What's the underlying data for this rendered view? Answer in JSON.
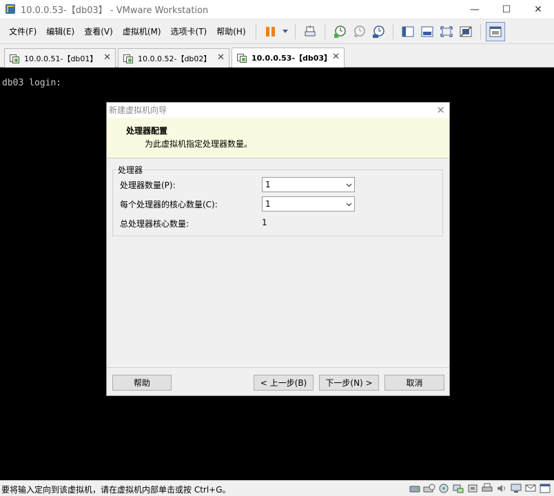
{
  "window": {
    "title": "10.0.0.53-【db03】 - VMware Workstation",
    "controls": {
      "minimize": "—",
      "maximize": "☐",
      "close": "✕"
    }
  },
  "menu": {
    "items": [
      "文件(F)",
      "编辑(E)",
      "查看(V)",
      "虚拟机(M)",
      "选项卡(T)",
      "帮助(H)"
    ]
  },
  "toolbar": {
    "buttons": [
      "pause-icon",
      "send-keys-icon",
      "snapshot-take-icon",
      "snapshot-revert-icon",
      "snapshot-manager-icon",
      "sidebar-toggle-icon",
      "console-view-icon",
      "fullscreen-icon",
      "unity-icon",
      "thumbnail-view-icon"
    ]
  },
  "tabs": [
    {
      "label": "10.0.0.51-【db01】",
      "active": false
    },
    {
      "label": "10.0.0.52-【db02】",
      "active": false
    },
    {
      "label": "10.0.0.53-【db03】",
      "active": true
    }
  ],
  "console": {
    "text": "db03 login:"
  },
  "dialog": {
    "title": "新建虚拟机向导",
    "heading": "处理器配置",
    "subheading": "为此虚拟机指定处理器数量。",
    "group_label": "处理器",
    "processor_count_label": "处理器数量(P):",
    "processor_count_value": "1",
    "cores_label": "每个处理器的核心数量(C):",
    "cores_value": "1",
    "total_cores_label": "总处理器核心数量:",
    "total_cores_value": "1",
    "buttons": {
      "help": "帮助",
      "back": "< 上一步(B)",
      "next": "下一步(N) >",
      "cancel": "取消"
    }
  },
  "status": {
    "text": "要将输入定向到该虚拟机，请在虚拟机内部单击或按 Ctrl+G。",
    "icons": [
      "hard-disk-icon",
      "cd-rom-icon",
      "network-icon",
      "network-adapter-icon",
      "usb-icon",
      "printer-icon",
      "sound-icon",
      "display-icon",
      "message-icon",
      "fullscreen-toggle-icon"
    ]
  },
  "colors": {
    "console_bg": "#000000",
    "dialog_header_bg": "#fafae0",
    "pause_orange": "#f0820e"
  }
}
